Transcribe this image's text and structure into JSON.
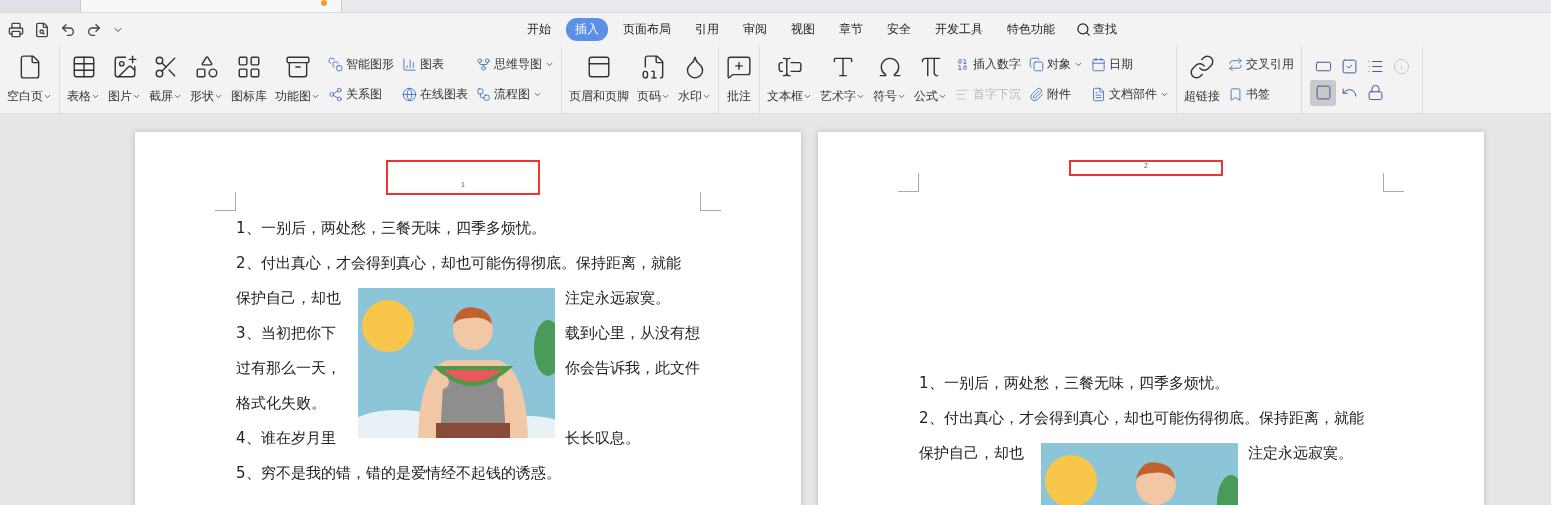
{
  "menu_tabs": [
    {
      "label": "开始",
      "selected": false
    },
    {
      "label": "插入",
      "selected": true
    },
    {
      "label": "页面布局",
      "selected": false
    },
    {
      "label": "引用",
      "selected": false
    },
    {
      "label": "审阅",
      "selected": false
    },
    {
      "label": "视图",
      "selected": false
    },
    {
      "label": "章节",
      "selected": false
    },
    {
      "label": "安全",
      "selected": false
    },
    {
      "label": "开发工具",
      "selected": false
    },
    {
      "label": "特色功能",
      "selected": false
    }
  ],
  "search": {
    "label": "查找"
  },
  "ribbon_groups": [
    {
      "items": [
        {
          "kind": "large",
          "label": "空白页",
          "dropdown": true
        }
      ]
    },
    {
      "items": [
        {
          "kind": "large",
          "label": "表格",
          "dropdown": true
        },
        {
          "kind": "large",
          "label": "图片",
          "dropdown": true
        },
        {
          "kind": "large",
          "label": "截屏",
          "dropdown": true
        },
        {
          "kind": "large",
          "label": "形状",
          "dropdown": true
        },
        {
          "kind": "large",
          "label": "图标库",
          "dropdown": false
        },
        {
          "kind": "large",
          "label": "功能图",
          "dropdown": true
        },
        {
          "kind": "stack",
          "entries": [
            {
              "label": "智能图形",
              "dropdown": false,
              "disabled": false
            },
            {
              "label": "关系图",
              "dropdown": false,
              "disabled": false
            }
          ]
        },
        {
          "kind": "stack",
          "entries": [
            {
              "label": "图表",
              "dropdown": false,
              "disabled": false
            },
            {
              "label": "在线图表",
              "dropdown": false,
              "disabled": false
            }
          ]
        },
        {
          "kind": "stack",
          "entries": [
            {
              "label": "思维导图",
              "dropdown": true,
              "disabled": false
            },
            {
              "label": "流程图",
              "dropdown": true,
              "disabled": false
            }
          ]
        }
      ]
    },
    {
      "items": [
        {
          "kind": "large",
          "label": "页眉和页脚",
          "dropdown": false
        },
        {
          "kind": "large",
          "label": "页码",
          "dropdown": true
        },
        {
          "kind": "large",
          "label": "水印",
          "dropdown": true
        }
      ]
    },
    {
      "items": [
        {
          "kind": "large",
          "label": "批注",
          "dropdown": false
        }
      ]
    },
    {
      "items": [
        {
          "kind": "large",
          "label": "文本框",
          "dropdown": true
        },
        {
          "kind": "large",
          "label": "艺术字",
          "dropdown": true
        },
        {
          "kind": "large",
          "label": "符号",
          "dropdown": true
        },
        {
          "kind": "large",
          "label": "公式",
          "dropdown": true
        },
        {
          "kind": "stack",
          "entries": [
            {
              "label": "插入数字",
              "dropdown": false,
              "disabled": false
            },
            {
              "label": "首字下沉",
              "dropdown": false,
              "disabled": true
            }
          ]
        },
        {
          "kind": "stack",
          "entries": [
            {
              "label": "对象",
              "dropdown": true,
              "disabled": false
            },
            {
              "label": "附件",
              "dropdown": false,
              "disabled": false
            }
          ]
        },
        {
          "kind": "stack",
          "entries": [
            {
              "label": "日期",
              "dropdown": false,
              "disabled": false
            },
            {
              "label": "文档部件",
              "dropdown": true,
              "disabled": false
            }
          ]
        }
      ]
    },
    {
      "items": [
        {
          "kind": "large",
          "label": "超链接",
          "dropdown": false
        },
        {
          "kind": "stack",
          "entries": [
            {
              "label": "交叉引用",
              "dropdown": false,
              "disabled": false
            },
            {
              "label": "书签",
              "dropdown": false,
              "disabled": false
            }
          ]
        }
      ]
    },
    {
      "items": [
        {
          "kind": "grid",
          "cells": [
            {
              "selected": false,
              "disabled": false
            },
            {
              "selected": false,
              "disabled": false
            },
            {
              "selected": false,
              "disabled": false
            },
            {
              "selected": false,
              "disabled": true
            },
            {
              "selected": true,
              "disabled": false
            },
            {
              "selected": false,
              "disabled": false
            },
            {
              "selected": false,
              "disabled": false
            }
          ]
        }
      ]
    }
  ],
  "pages": [
    {
      "page_number": "1",
      "lines_before": [
        "1、一别后，两处愁，三餐无味，四季多烦忧。",
        "2、付出真心，才会得到真心，却也可能伤得彻底。保持距离，就能"
      ],
      "wrap": [
        {
          "left": "保护自己，却也",
          "right": "注定永远寂寞。"
        },
        {
          "left": "3、当初把你下",
          "right": "载到心里，从没有想"
        },
        {
          "left": "过有那么一天，",
          "right": "你会告诉我，此文件"
        },
        {
          "left": "格式化失败。"
        },
        {
          "left": "4、谁在岁月里",
          "right": "长长叹息。"
        }
      ],
      "lines_after": [
        "5、穷不是我的错，错的是爱情经不起钱的诱惑。"
      ]
    },
    {
      "page_number": "2",
      "lines_before": [
        "1、一别后，两处愁，三餐无味，四季多烦忧。",
        "2、付出真心，才会得到真心，却也可能伤得彻底。保持距离，就能"
      ],
      "wrap": [
        {
          "left": "保护自己，却也",
          "right": "注定永远寂寞。"
        }
      ]
    }
  ]
}
